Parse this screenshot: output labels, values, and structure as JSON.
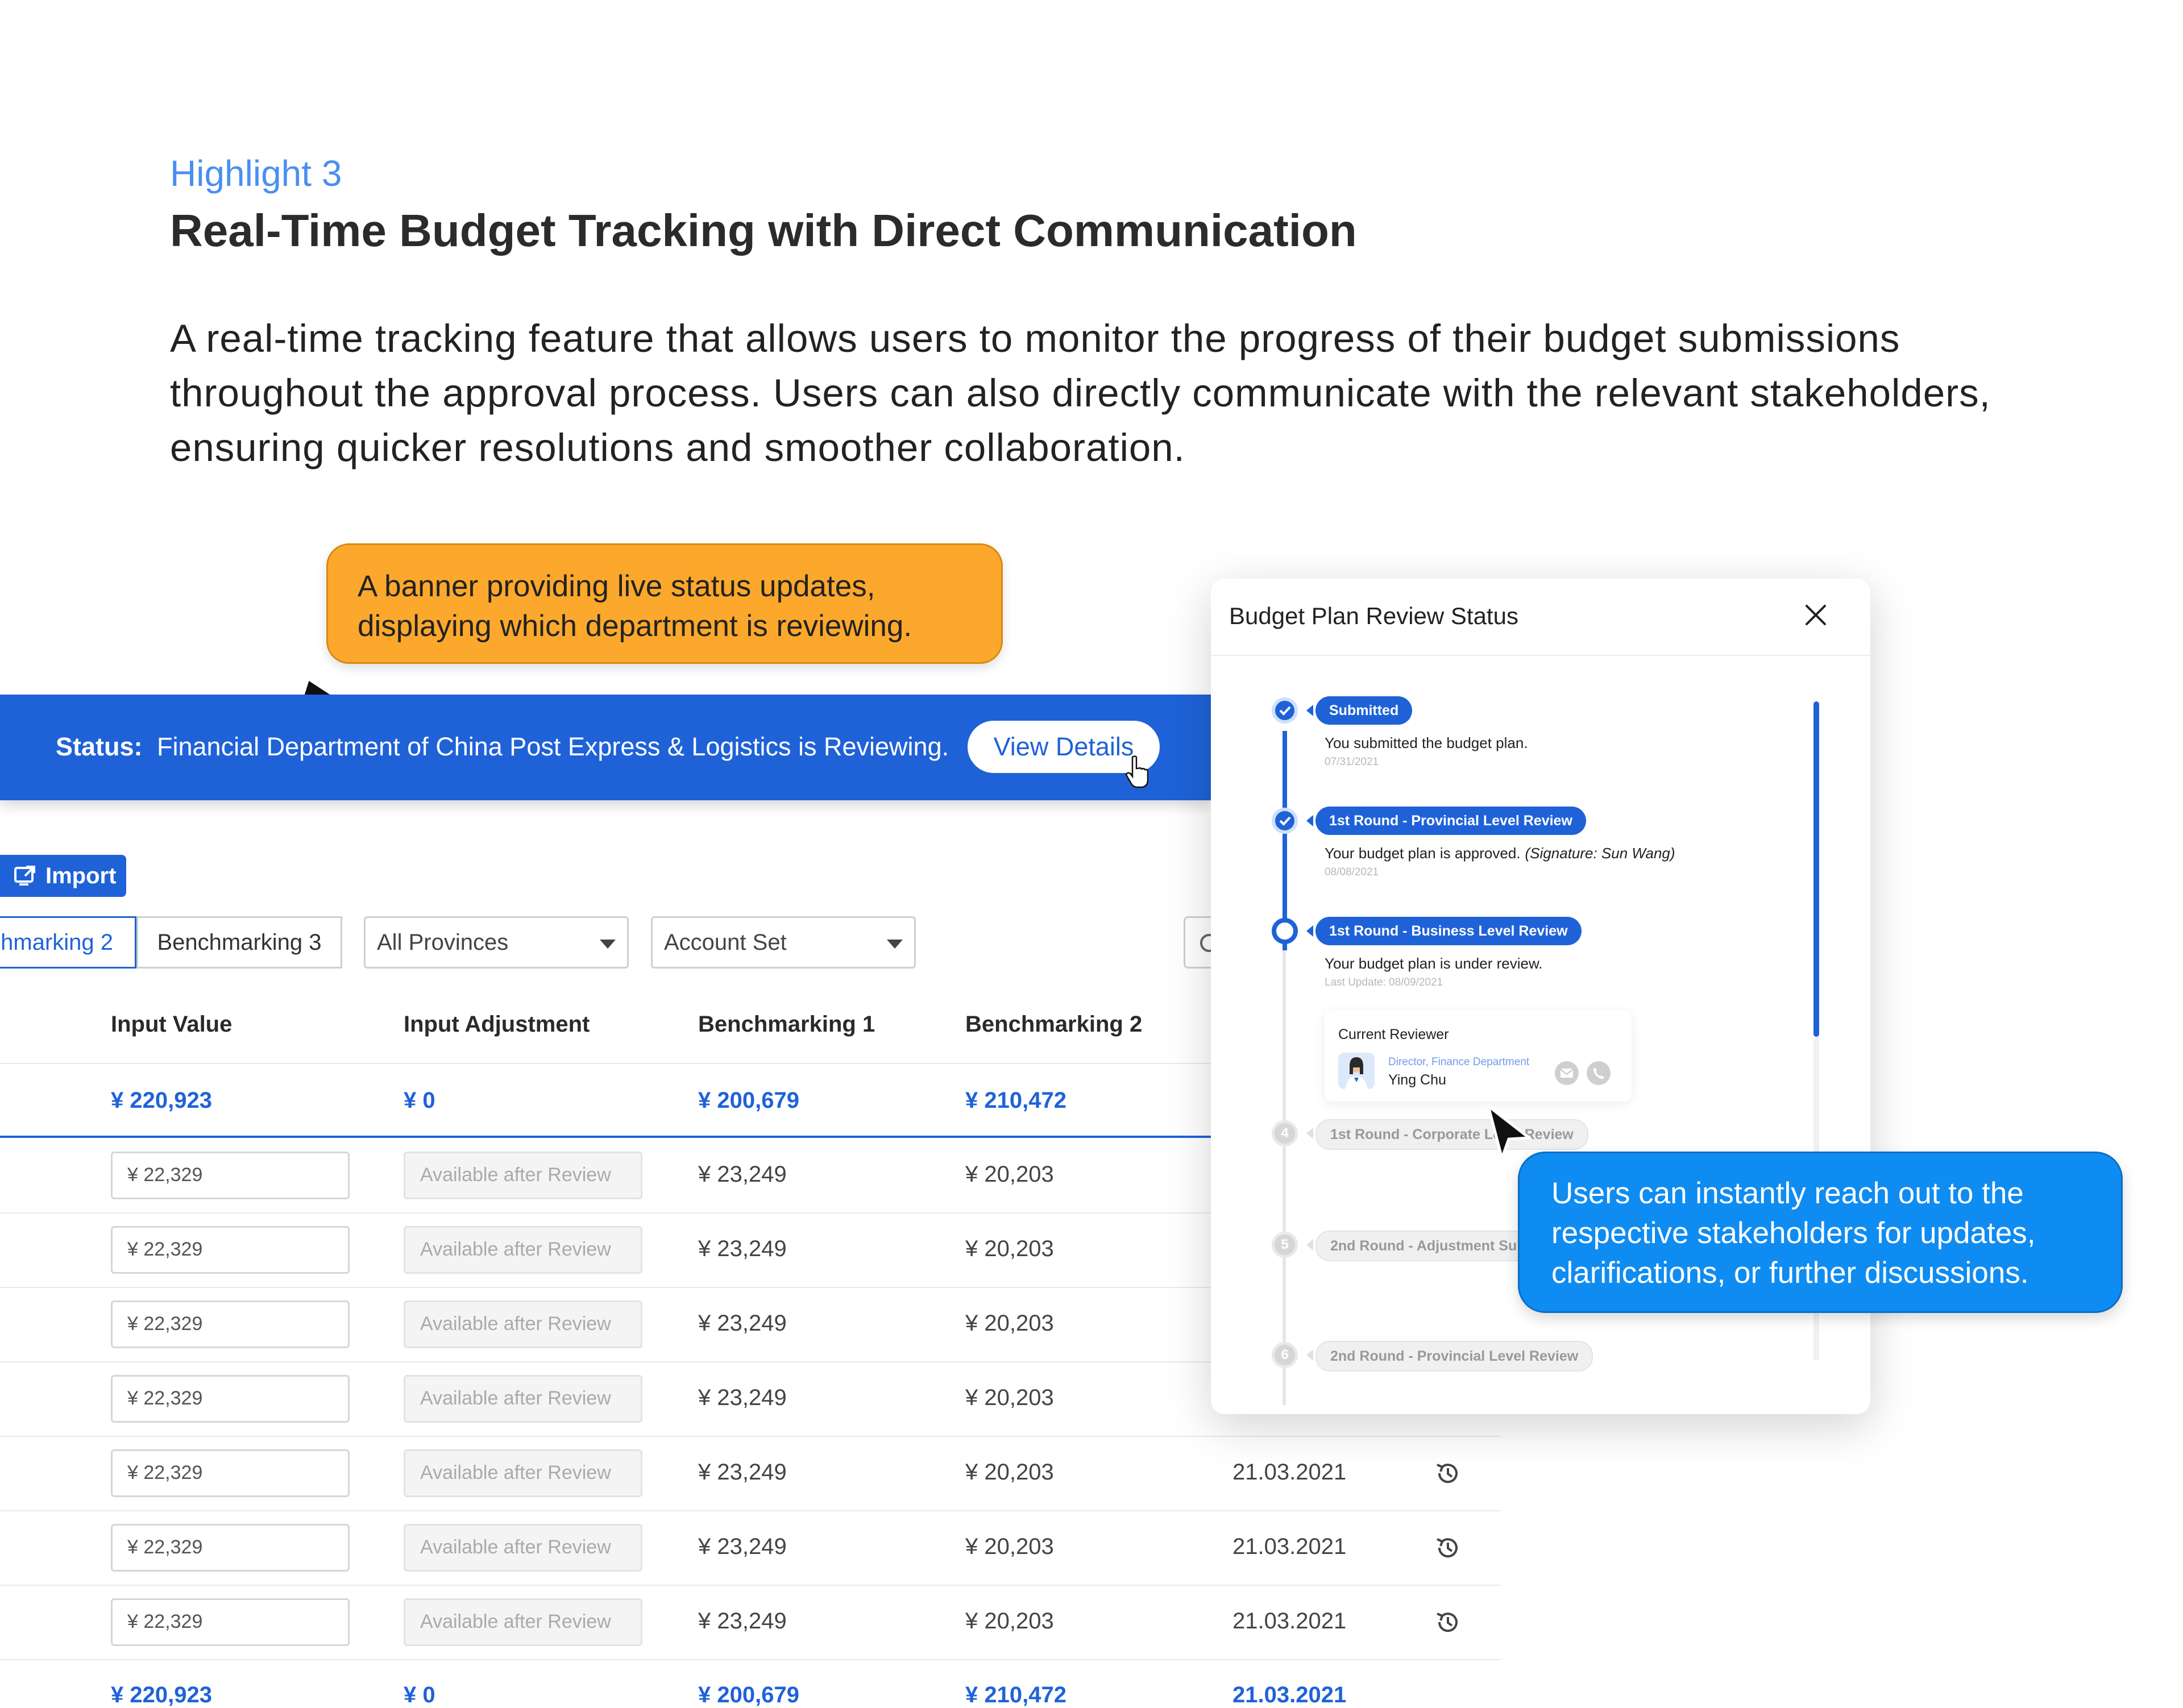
{
  "header": {
    "eyebrow": "Highlight 3",
    "title": "Real-Time Budget Tracking with Direct Communication",
    "description": "A real-time tracking feature that allows users to monitor the progress of their budget submissions throughout the approval process. Users can also directly communicate with the relevant stakeholders, ensuring quicker resolutions and smoother collaboration."
  },
  "callouts": {
    "banner_note": "A banner providing live status updates, displaying which department is reviewing.",
    "contact_note": "Users can instantly reach out to the respective stakeholders for updates, clarifications, or further discussions."
  },
  "status_banner": {
    "label": "Status:",
    "text": "Financial Department of China Post Express & Logistics is Reviewing.",
    "button": "View Details"
  },
  "toolbar": {
    "import_label": "Import",
    "tabs": [
      "hmarking 2",
      "Benchmarking 3"
    ],
    "province_select": "All Provinces",
    "account_select": "Account Set"
  },
  "table": {
    "columns": [
      "Input Value",
      "Input Adjustment",
      "Benchmarking 1",
      "Benchmarking 2"
    ],
    "top_total": [
      "¥ 220,923",
      "¥ 0",
      "¥ 200,679",
      "¥ 210,472"
    ],
    "rows": [
      {
        "input": "¥ 22,329",
        "adjust": "Available after Review",
        "b1": "¥ 23,249",
        "b2": "¥ 20,203",
        "date": ""
      },
      {
        "input": "¥ 22,329",
        "adjust": "Available after Review",
        "b1": "¥ 23,249",
        "b2": "¥ 20,203",
        "date": ""
      },
      {
        "input": "¥ 22,329",
        "adjust": "Available after Review",
        "b1": "¥ 23,249",
        "b2": "¥ 20,203",
        "date": ""
      },
      {
        "input": "¥ 22,329",
        "adjust": "Available after Review",
        "b1": "¥ 23,249",
        "b2": "¥ 20,203",
        "date": ""
      },
      {
        "input": "¥ 22,329",
        "adjust": "Available after Review",
        "b1": "¥ 23,249",
        "b2": "¥ 20,203",
        "date": "21.03.2021"
      },
      {
        "input": "¥ 22,329",
        "adjust": "Available after Review",
        "b1": "¥ 23,249",
        "b2": "¥ 20,203",
        "date": "21.03.2021"
      },
      {
        "input": "¥ 22,329",
        "adjust": "Available after Review",
        "b1": "¥ 23,249",
        "b2": "¥ 20,203",
        "date": "21.03.2021"
      }
    ],
    "bottom_total": [
      "¥ 220,923",
      "¥ 0",
      "¥ 200,679",
      "¥ 210,472",
      "21.03.2021"
    ]
  },
  "modal": {
    "title": "Budget Plan Review Status",
    "steps": [
      {
        "label": "Submitted",
        "state": "done",
        "number": "",
        "desc": "You submitted the budget plan.",
        "desc_note": "",
        "date": "07/31/2021"
      },
      {
        "label": "1st Round - Provincial Level Review",
        "state": "done",
        "number": "",
        "desc": "Your budget plan is approved.",
        "desc_note": "(Signature: Sun Wang)",
        "date": "08/08/2021"
      },
      {
        "label": "1st Round - Business Level Review",
        "state": "current",
        "number": "",
        "desc": "Your budget plan is under review.",
        "desc_note": "",
        "date": "Last Update: 08/09/2021"
      },
      {
        "label": "1st Round - Corporate Level Review",
        "state": "todo",
        "number": "4",
        "desc": "",
        "desc_note": "",
        "date": ""
      },
      {
        "label": "2nd Round - Adjustment Submission",
        "state": "todo",
        "number": "5",
        "desc": "",
        "desc_note": "",
        "date": ""
      },
      {
        "label": "2nd Round - Provincial Level Review",
        "state": "todo",
        "number": "6",
        "desc": "",
        "desc_note": "",
        "date": ""
      }
    ],
    "reviewer": {
      "title": "Current Reviewer",
      "role": "Director, Finance Department",
      "name": "Ying Chu"
    }
  },
  "icons": [
    "import-icon",
    "caret-down-icon",
    "search-icon",
    "history-icon",
    "close-icon",
    "check-icon",
    "mail-icon",
    "phone-icon",
    "hand-cursor-icon",
    "arrow-cursor-icon"
  ],
  "colors": {
    "primary": "#1f62d8",
    "orange_callout": "#fba82c",
    "blue_callout": "#0f8cf2"
  }
}
